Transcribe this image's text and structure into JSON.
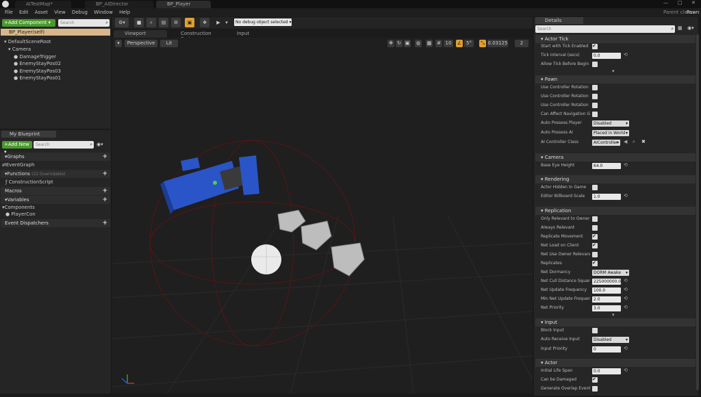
{
  "tabs": [
    {
      "label": "AITestMap*"
    },
    {
      "label": "BP_AIDirector"
    },
    {
      "label": "BP_Player"
    }
  ],
  "parent_class": {
    "label": "Parent class:",
    "value": "Pawn"
  },
  "menu": [
    "File",
    "Edit",
    "Asset",
    "View",
    "Debug",
    "Window",
    "Help"
  ],
  "components": {
    "add_label": "+Add Component ▾",
    "search_placeholder": "Search",
    "self_item": "BP_Player(self)",
    "tree": [
      "DefaultSceneRoot",
      "Camera",
      "DamageTrigger",
      "EnemyStayPos02",
      "EnemyStayPos03",
      "EnemyStayPos01"
    ]
  },
  "my_blueprint": {
    "tab": "My Blueprint",
    "add_new": "+Add New ▾",
    "search_placeholder": "Search",
    "sections": {
      "graphs": "Graphs",
      "event_graph": "EventGraph",
      "functions": "Functions",
      "functions_count": "(22 Overridable)",
      "construction": "ConstructionScript",
      "macros": "Macros",
      "variables": "Variables",
      "components": "Components",
      "player_con": "PlayerCon",
      "dispatchers": "Event Dispatchers"
    }
  },
  "toolbar": {
    "debug_object": "No debug object selected ▾"
  },
  "editor_tabs": [
    "Viewport",
    "Construction Scrip",
    "Input"
  ],
  "viewport": {
    "perspective": "Perspective",
    "lit": "Lit",
    "grid_snap": "10",
    "rot_snap": "5°",
    "scale_snap": "0.03125",
    "cam_speed": "2"
  },
  "details": {
    "tab": "Details",
    "search_placeholder": "Search",
    "sections": {
      "actor_tick": "Actor Tick",
      "pawn": "Pawn",
      "camera": "Camera",
      "rendering": "Rendering",
      "replication": "Replication",
      "input": "Input",
      "actor": "Actor"
    },
    "props": {
      "start_tick": "Start with Tick Enabled",
      "tick_interval": "Tick Interval (secs)",
      "tick_interval_val": "0.0",
      "allow_tick": "Allow Tick Before Begin Pla",
      "ctrl_pitch": "Use Controller Rotation Pitc",
      "ctrl_yaw": "Use Controller Rotation Yaw",
      "ctrl_roll": "Use Controller Rotation Roll",
      "affect_nav": "Can Affect Navigation Gene",
      "auto_player": "Auto Possess Player",
      "auto_player_val": "Disabled",
      "auto_ai": "Auto Possess AI",
      "auto_ai_val": "Placed in World",
      "ai_class": "AI Controller Class",
      "ai_class_val": "AIController",
      "eye_height": "Base Eye Height",
      "eye_height_val": "64.0",
      "hidden": "Actor Hidden In Game",
      "billboard": "Editor Billboard Scale",
      "billboard_val": "1.0",
      "only_owner": "Only Relevant to Owner",
      "always_rel": "Always Relevant",
      "rep_move": "Replicate Movement",
      "net_load": "Net Load on Client",
      "net_owner_rel": "Net Use Owner Relevancy",
      "replicates": "Replicates",
      "dormancy": "Net Dormancy",
      "dormancy_val": "DORM Awake",
      "cull": "Net Cull Distance Squared",
      "cull_val": "225000000.0",
      "update_freq": "Net Update Frequency",
      "update_freq_val": "100.0",
      "min_update": "Min Net Update Frequency",
      "min_update_val": "2.0",
      "priority": "Net Priority",
      "priority_val": "3.0",
      "block_input": "Block Input",
      "auto_recv": "Auto Receive Input",
      "auto_recv_val": "Disabled",
      "input_prio": "Input Priority",
      "input_prio_val": "0",
      "life_span": "Initial Life Span",
      "life_span_val": "0.0",
      "can_damage": "Can be Damaged",
      "overlap": "Generate Overlap Events D"
    }
  },
  "colors": {
    "accent": "#e0a030",
    "green": "#4a9a2c",
    "panel": "#252525",
    "viewport": "#1f1f1f"
  }
}
